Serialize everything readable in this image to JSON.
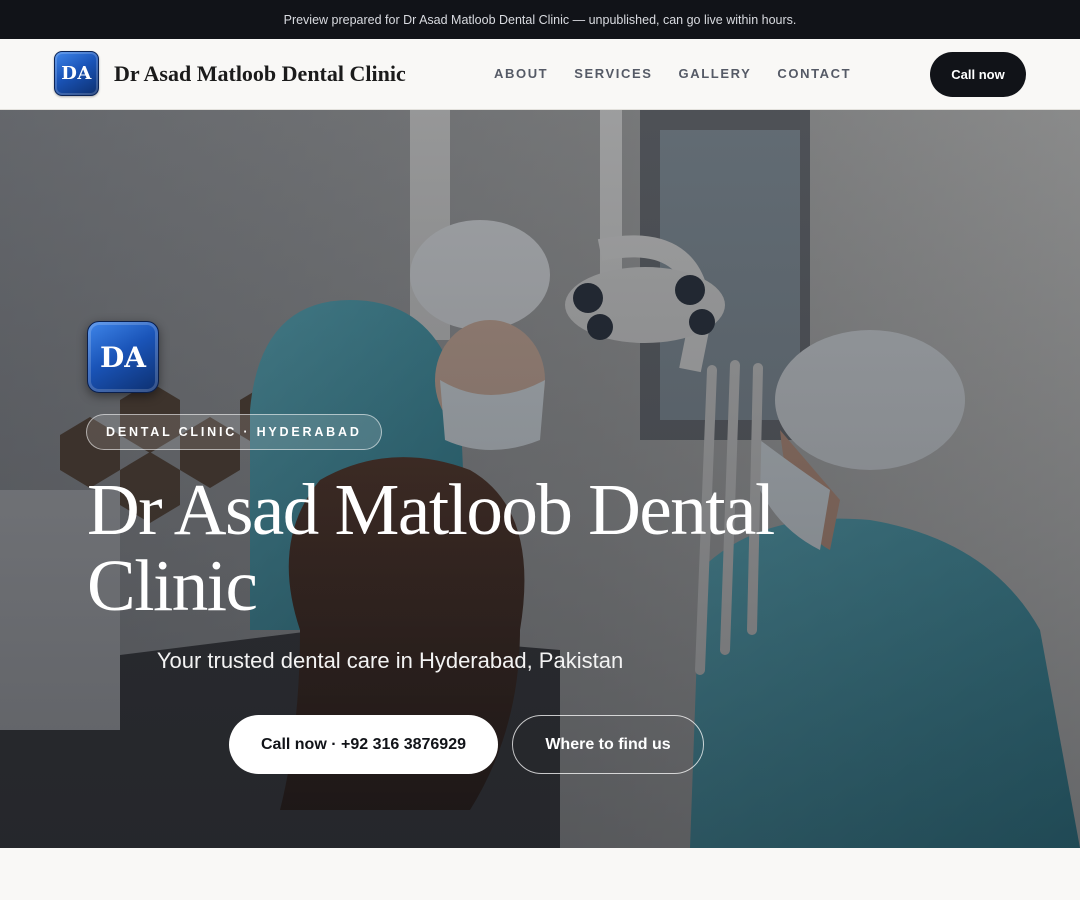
{
  "preview_bar": {
    "text": "Preview prepared for Dr Asad Matloob Dental Clinic — unpublished, can go live within hours."
  },
  "header": {
    "logo_text": "DA",
    "site_name": "Dr Asad Matloob Dental Clinic",
    "nav": [
      "ABOUT",
      "SERVICES",
      "GALLERY",
      "CONTACT"
    ],
    "cta_label": "Call now"
  },
  "hero": {
    "logo_text": "DA",
    "tag": "DENTAL CLINIC · HYDERABAD",
    "title": "Dr Asad Matloob Dental Clinic",
    "subtitle": "Your trusted dental care in Hyderabad, Pakistan",
    "primary_button": "Call now · +92 316 3876929",
    "secondary_button": "Where to find us"
  },
  "colors": {
    "brand_blue": "#1a54b8",
    "dark": "#111318",
    "page_bg": "#f9f8f6",
    "scrub_teal": "#4aa6b8"
  }
}
